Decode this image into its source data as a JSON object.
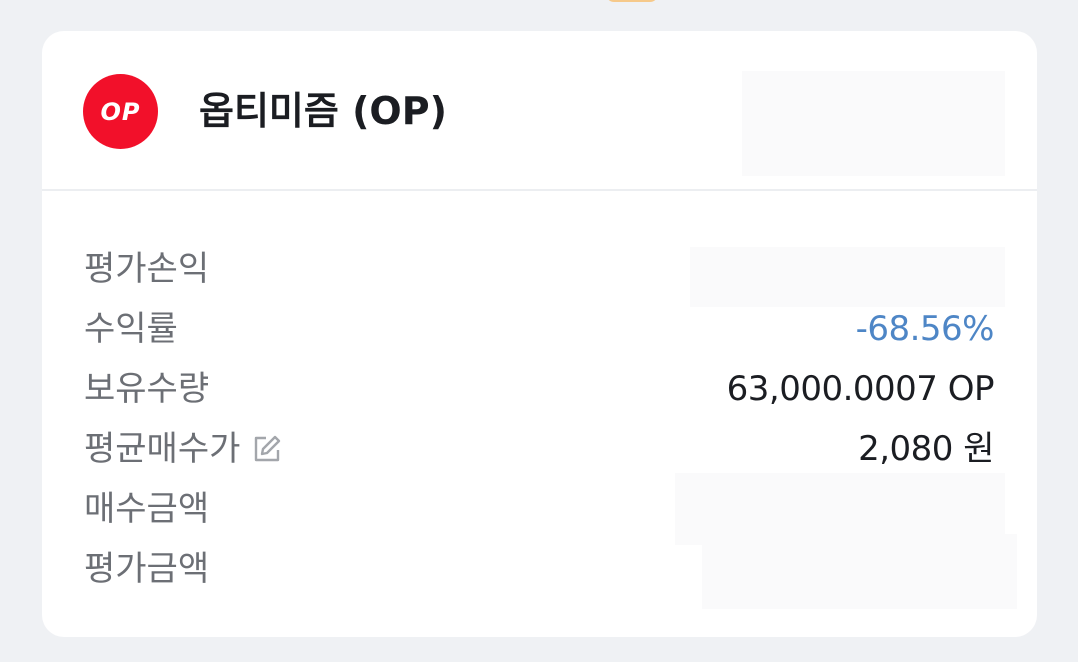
{
  "coin": {
    "logo_text": "OP",
    "name": "옵티미즘 (OP)",
    "brand_color": "#f2102a"
  },
  "colors": {
    "negative": "#4e86c6",
    "label": "#6c6f75",
    "value": "#1b1d22"
  },
  "rows": [
    {
      "label": "평가손익",
      "value": ""
    },
    {
      "label": "수익률",
      "value": "-68.56%"
    },
    {
      "label": "보유수량",
      "value": "63,000.0007 OP"
    },
    {
      "label": "평균매수가",
      "value": "2,080 원",
      "icon": "edit-icon"
    },
    {
      "label": "매수금액",
      "value": ""
    },
    {
      "label": "평가금액",
      "value": ""
    }
  ]
}
